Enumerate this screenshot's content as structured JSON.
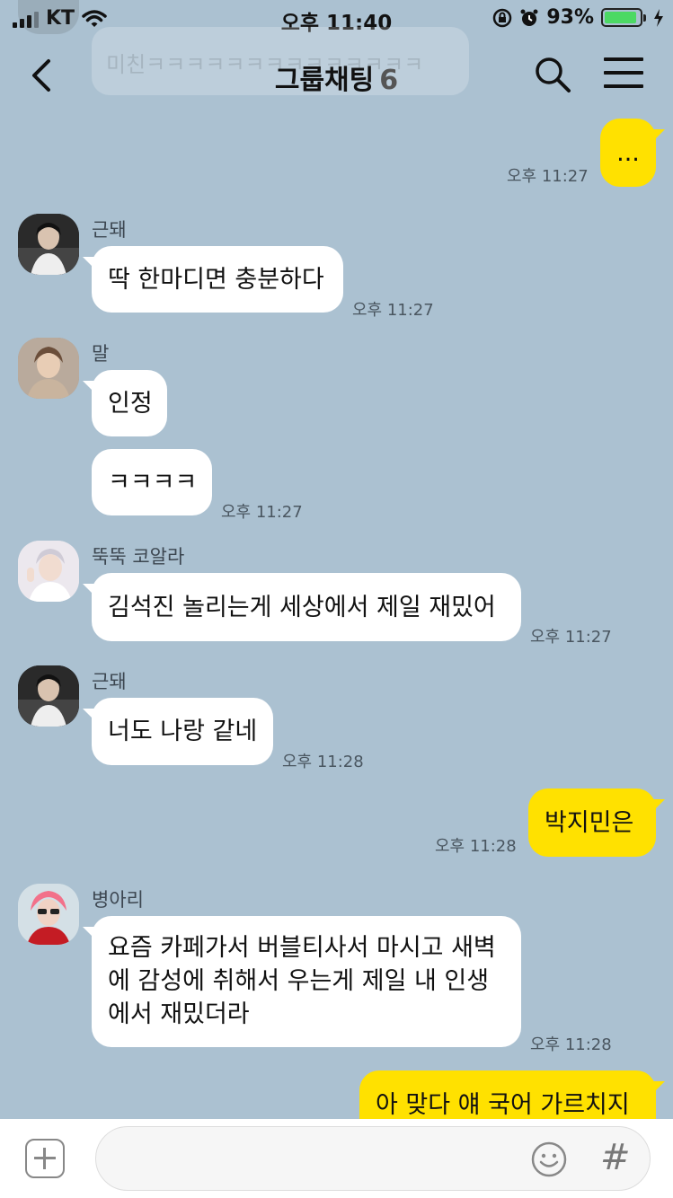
{
  "status_bar": {
    "carrier": "KT",
    "time": "오후 11:40",
    "battery_text": "93%",
    "battery_level": 0.93,
    "battery_color": "#4cd964"
  },
  "header": {
    "title": "그룹채팅",
    "member_count": "6",
    "back_icon": "chevron-left-icon",
    "search_icon": "search-icon",
    "menu_icon": "hamburger-menu-icon"
  },
  "ghost_message": {
    "text": "미친ㅋㅋㅋㅋㅋㅋㅋㅋㅋㅋㅋㅋㅋㅋ"
  },
  "messages": [
    {
      "from": "me",
      "text": "...",
      "time": "오후 11:27"
    },
    {
      "from": "other",
      "sender": "근돼",
      "text": "딱 한마디면 충분하다",
      "time": "오후 11:27"
    },
    {
      "from": "other",
      "sender": "말",
      "text": "인정"
    },
    {
      "from": "other",
      "text": "ㅋㅋㅋㅋ",
      "time": "오후 11:27"
    },
    {
      "from": "other",
      "sender": "뚝뚝 코알라",
      "text": "김석진 놀리는게 세상에서 제일 재밌어",
      "time": "오후 11:27"
    },
    {
      "from": "other",
      "sender": "근돼",
      "text": "너도 나랑 같네",
      "time": "오후 11:28"
    },
    {
      "from": "me",
      "text": "박지민은",
      "time": "오후 11:28"
    },
    {
      "from": "other",
      "sender": "병아리",
      "text": "요즘 카페가서 버블티사서 마시고 새벽에 감성에 취해서 우는게 제일 내 인생에서 재밌더라",
      "time": "오후 11:28"
    },
    {
      "from": "me",
      "text": "아 맞다 얘 국어 가르치지"
    }
  ],
  "colors": {
    "background": "#abc1d1",
    "my_bubble": "#ffe100",
    "other_bubble": "#ffffff"
  },
  "input_bar": {
    "placeholder": "",
    "plus_icon": "plus-square-icon",
    "emoji_icon": "smiley-icon",
    "hash_icon": "hash-icon",
    "hash_label": "#"
  }
}
